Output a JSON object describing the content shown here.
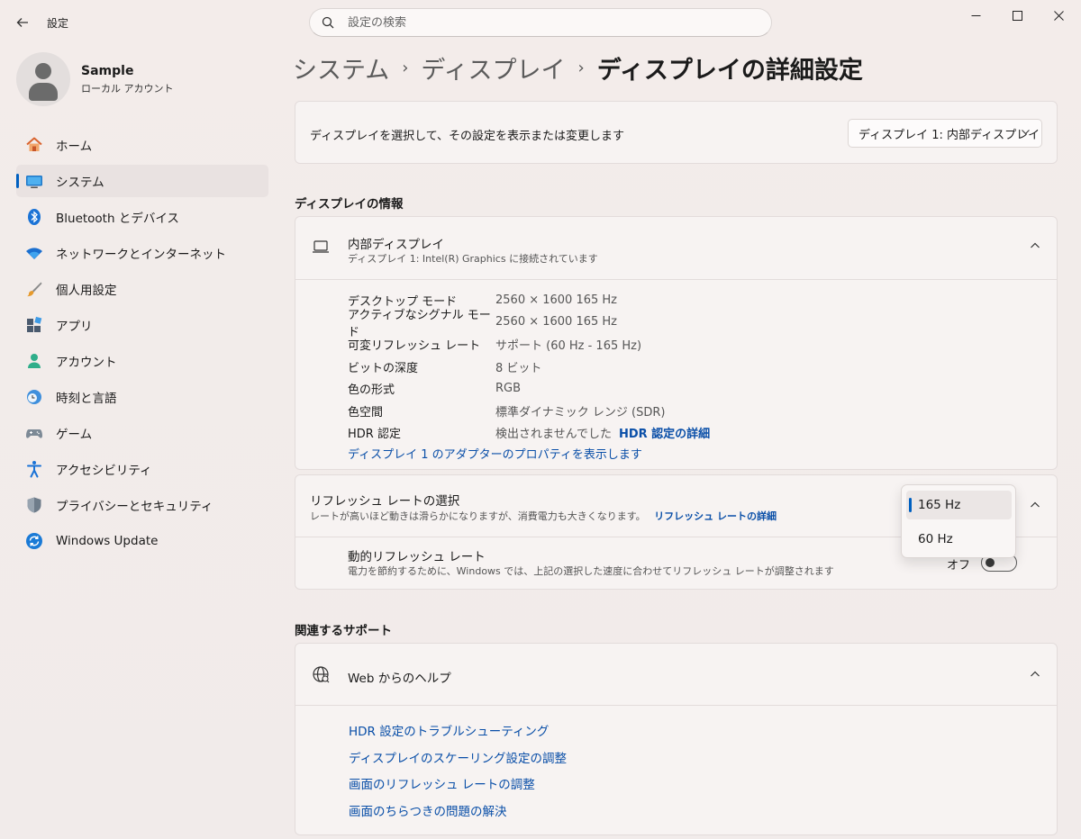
{
  "window": {
    "app_title": "設定",
    "search_placeholder": "設定の検索"
  },
  "profile": {
    "name": "Sample",
    "account_type": "ローカル アカウント"
  },
  "sidebar": {
    "items": [
      {
        "label": "ホーム",
        "icon": "home-icon"
      },
      {
        "label": "システム",
        "icon": "system-icon",
        "active": true
      },
      {
        "label": "Bluetooth とデバイス",
        "icon": "bluetooth-icon"
      },
      {
        "label": "ネットワークとインターネット",
        "icon": "wifi-icon"
      },
      {
        "label": "個人用設定",
        "icon": "brush-icon"
      },
      {
        "label": "アプリ",
        "icon": "apps-icon"
      },
      {
        "label": "アカウント",
        "icon": "account-icon"
      },
      {
        "label": "時刻と言語",
        "icon": "time-language-icon"
      },
      {
        "label": "ゲーム",
        "icon": "gamepad-icon"
      },
      {
        "label": "アクセシビリティ",
        "icon": "accessibility-icon"
      },
      {
        "label": "プライバシーとセキュリティ",
        "icon": "shield-icon"
      },
      {
        "label": "Windows Update",
        "icon": "update-icon"
      }
    ]
  },
  "breadcrumb": [
    "システム",
    "ディスプレイ",
    "ディスプレイの詳細設定"
  ],
  "select_display": {
    "label": "ディスプレイを選択して、その設定を表示または変更します",
    "selected": "ディスプレイ 1: 内部ディスプレイ"
  },
  "display_info": {
    "section_title": "ディスプレイの情報",
    "title": "内部ディスプレイ",
    "subtitle": "ディスプレイ 1: Intel(R) Graphics に接続されています",
    "rows": [
      {
        "key": "デスクトップ モード",
        "value": "2560 × 1600 165 Hz"
      },
      {
        "key": "アクティブなシグナル モード",
        "value": "2560 × 1600 165 Hz"
      },
      {
        "key": "可変リフレッシュ レート",
        "value": "サポート (60 Hz - 165 Hz)"
      },
      {
        "key": "ビットの深度",
        "value": "8 ビット"
      },
      {
        "key": "色の形式",
        "value": "RGB"
      },
      {
        "key": "色空間",
        "value": "標準ダイナミック レンジ (SDR)"
      },
      {
        "key": "HDR 認定",
        "value": "検出されませんでした",
        "link": "HDR 認定の詳細"
      }
    ],
    "adapter_link": "ディスプレイ 1 のアダプターのプロパティを表示します"
  },
  "refresh": {
    "title": "リフレッシュ レートの選択",
    "subtitle": "レートが高いほど動きは滑らかになりますが、消費電力も大きくなります。",
    "link": "リフレッシュ レートの詳細",
    "options": [
      "165 Hz",
      "60 Hz"
    ],
    "selected": "165 Hz",
    "dynamic_title": "動的リフレッシュ レート",
    "dynamic_subtitle": "電力を節約するために、Windows では、上記の選択した速度に合わせてリフレッシュ レートが調整されます",
    "dynamic_state": "オフ"
  },
  "support": {
    "section_title": "関連するサポート",
    "title": "Web からのヘルプ",
    "links": [
      "HDR 設定のトラブルシューティング",
      "ディスプレイのスケーリング設定の調整",
      "画面のリフレッシュ レートの調整",
      "画面のちらつきの問題の解決"
    ]
  },
  "colors": {
    "accent": "#0060c0",
    "link": "#0a4fa8",
    "background": "#f1ebea",
    "card": "#f7f3f2"
  }
}
